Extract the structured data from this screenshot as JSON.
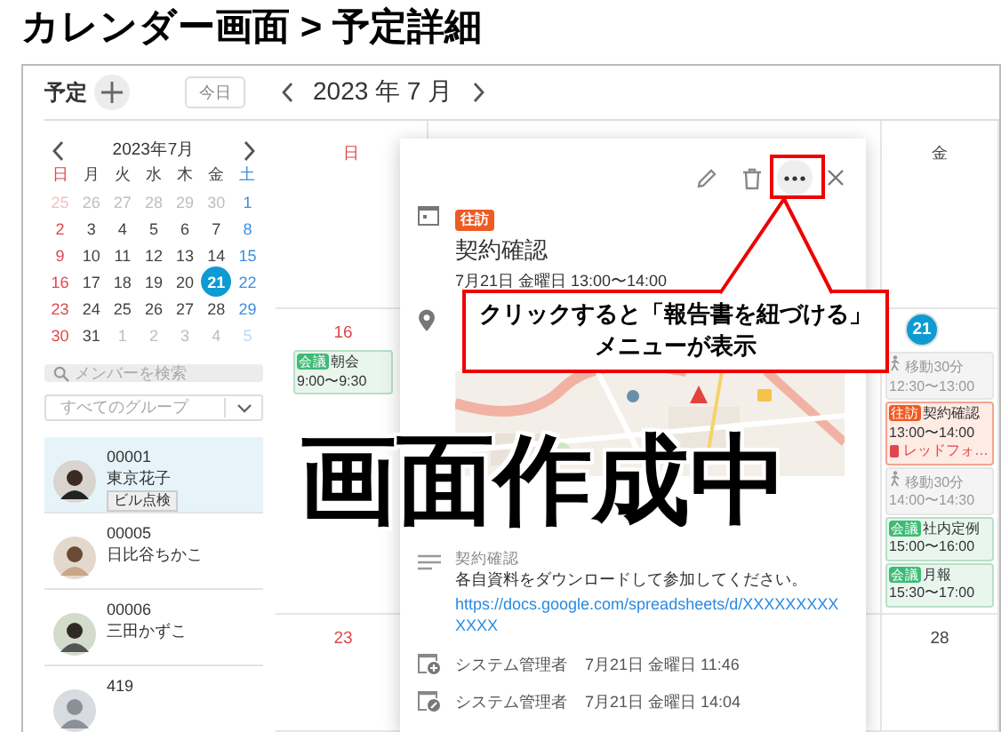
{
  "page_title": "カレンダー画面 > 予定詳細",
  "header": {
    "title": "予定",
    "today_button": "今日",
    "month": "2023 年 7 月"
  },
  "mini_calendar": {
    "month": "2023年7月",
    "weekdays": [
      {
        "label": "日",
        "kind": "sun"
      },
      {
        "label": "月",
        "kind": "weekday"
      },
      {
        "label": "火",
        "kind": "weekday"
      },
      {
        "label": "水",
        "kind": "weekday"
      },
      {
        "label": "木",
        "kind": "weekday"
      },
      {
        "label": "金",
        "kind": "weekday"
      },
      {
        "label": "土",
        "kind": "sat"
      }
    ],
    "weeks": [
      [
        {
          "day": "25",
          "outside": true,
          "selected": false
        },
        {
          "day": "26",
          "outside": true,
          "selected": false
        },
        {
          "day": "27",
          "outside": true,
          "selected": false
        },
        {
          "day": "28",
          "outside": true,
          "selected": false
        },
        {
          "day": "29",
          "outside": true,
          "selected": false
        },
        {
          "day": "30",
          "outside": true,
          "selected": false
        },
        {
          "day": "1",
          "outside": false,
          "selected": false
        }
      ],
      [
        {
          "day": "2",
          "outside": false,
          "selected": false
        },
        {
          "day": "3",
          "outside": false,
          "selected": false
        },
        {
          "day": "4",
          "outside": false,
          "selected": false
        },
        {
          "day": "5",
          "outside": false,
          "selected": false
        },
        {
          "day": "6",
          "outside": false,
          "selected": false
        },
        {
          "day": "7",
          "outside": false,
          "selected": false
        },
        {
          "day": "8",
          "outside": false,
          "selected": false
        }
      ],
      [
        {
          "day": "9",
          "outside": false,
          "selected": false
        },
        {
          "day": "10",
          "outside": false,
          "selected": false
        },
        {
          "day": "11",
          "outside": false,
          "selected": false
        },
        {
          "day": "12",
          "outside": false,
          "selected": false
        },
        {
          "day": "13",
          "outside": false,
          "selected": false
        },
        {
          "day": "14",
          "outside": false,
          "selected": false
        },
        {
          "day": "15",
          "outside": false,
          "selected": false
        }
      ],
      [
        {
          "day": "16",
          "outside": false,
          "selected": false
        },
        {
          "day": "17",
          "outside": false,
          "selected": false
        },
        {
          "day": "18",
          "outside": false,
          "selected": false
        },
        {
          "day": "19",
          "outside": false,
          "selected": false
        },
        {
          "day": "20",
          "outside": false,
          "selected": false
        },
        {
          "day": "21",
          "outside": false,
          "selected": true
        },
        {
          "day": "22",
          "outside": false,
          "selected": false
        }
      ],
      [
        {
          "day": "23",
          "outside": false,
          "selected": false
        },
        {
          "day": "24",
          "outside": false,
          "selected": false
        },
        {
          "day": "25",
          "outside": false,
          "selected": false
        },
        {
          "day": "26",
          "outside": false,
          "selected": false
        },
        {
          "day": "27",
          "outside": false,
          "selected": false
        },
        {
          "day": "28",
          "outside": false,
          "selected": false
        },
        {
          "day": "29",
          "outside": false,
          "selected": false
        }
      ],
      [
        {
          "day": "30",
          "outside": false,
          "selected": false
        },
        {
          "day": "31",
          "outside": false,
          "selected": false
        },
        {
          "day": "1",
          "outside": true,
          "selected": false
        },
        {
          "day": "2",
          "outside": true,
          "selected": false
        },
        {
          "day": "3",
          "outside": true,
          "selected": false
        },
        {
          "day": "4",
          "outside": true,
          "selected": false
        },
        {
          "day": "5",
          "outside": true,
          "selected": false
        }
      ]
    ]
  },
  "member_search": {
    "placeholder": "メンバーを検索"
  },
  "group_select": {
    "value": "すべてのグループ"
  },
  "members": [
    {
      "id": "00001",
      "name": "東京花子",
      "tag": "ビル点検",
      "selected": true
    },
    {
      "id": "00005",
      "name": "日比谷ちかこ",
      "selected": false
    },
    {
      "id": "00006",
      "name": "三田かずこ",
      "selected": false
    },
    {
      "id": "419",
      "selected": false
    }
  ],
  "calendar": {
    "columns": [
      {
        "label": "日",
        "kind": "sun",
        "cells": [
          {
            "date": "16",
            "today": false,
            "events": [
              {
                "kind": "meeting",
                "tag": "会議",
                "title": "朝会",
                "time": "9:00〜9:30"
              }
            ]
          },
          {
            "date": "23",
            "today": false
          }
        ]
      },
      {
        "label": "金",
        "kind": "weekday",
        "cells": [
          {
            "date": "21",
            "today": true,
            "events": [
              {
                "kind": "travel",
                "title": "移動30分",
                "time": "12:30〜13:00"
              },
              {
                "kind": "visit",
                "tag": "往訪",
                "title": "契約確認",
                "time": "13:00〜14:00",
                "location": "レッドフォ…"
              },
              {
                "kind": "travel",
                "title": "移動30分",
                "time": "14:00〜14:30"
              },
              {
                "kind": "meeting",
                "tag": "会議",
                "title": "社内定例",
                "time": "15:00〜16:00"
              },
              {
                "kind": "meeting",
                "tag": "会議",
                "title": "月報",
                "time": "15:30〜17:00"
              }
            ]
          },
          {
            "date": "28",
            "today": false
          }
        ]
      }
    ]
  },
  "event_detail": {
    "tag": "往訪",
    "title": "契約確認",
    "datetime": "7月21日 金曜日 13:00〜14:00",
    "description_title": "契約確認",
    "description": "各自資料をダウンロードして参加してください。",
    "link": "https://docs.google.com/spreadsheets/d/XXXXXXXXXXXXX",
    "history": [
      {
        "kind": "created",
        "user": "システム管理者",
        "time": "7月21日 金曜日 11:46"
      },
      {
        "kind": "edited",
        "user": "システム管理者",
        "time": "7月21日 金曜日 14:04"
      }
    ]
  },
  "annotations": {
    "callout_lines": [
      "クリックすると「報告書を紐づける」",
      "メニューが表示"
    ],
    "stamp": "画面作成中"
  }
}
